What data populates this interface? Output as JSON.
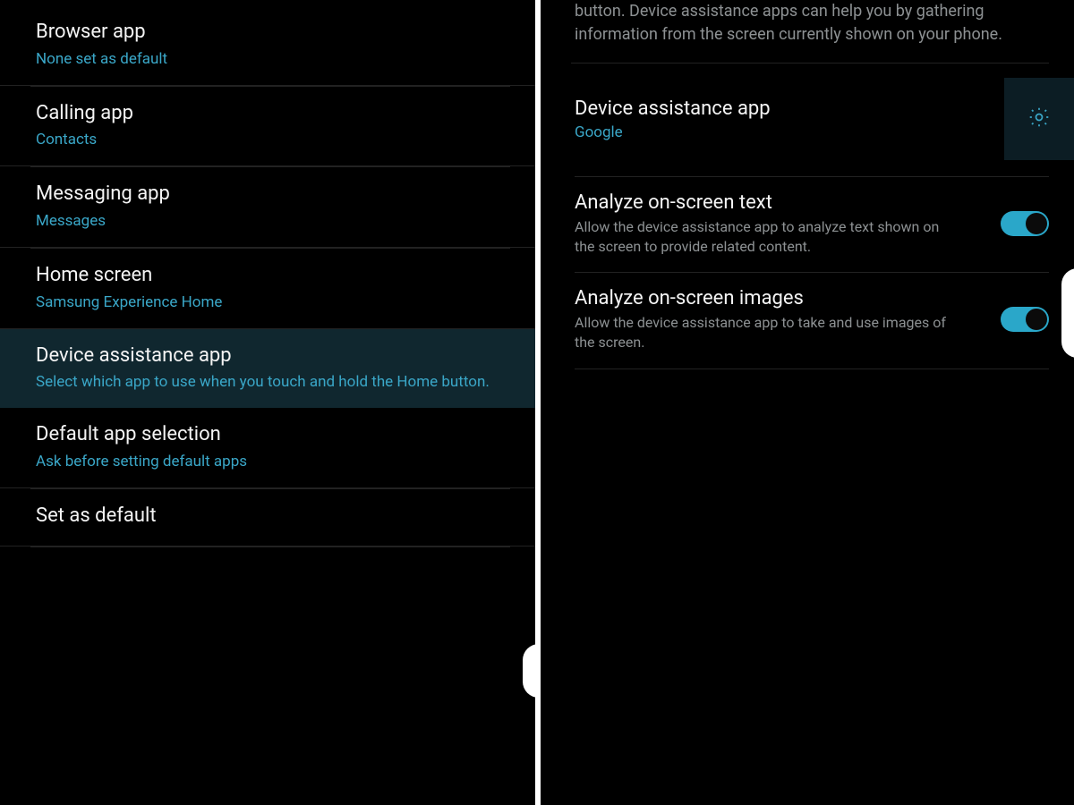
{
  "left": {
    "items": [
      {
        "title": "Browser app",
        "sub": "None set as default"
      },
      {
        "title": "Calling app",
        "sub": "Contacts"
      },
      {
        "title": "Messaging app",
        "sub": "Messages"
      },
      {
        "title": "Home screen",
        "sub": "Samsung Experience Home"
      },
      {
        "title": "Device assistance app",
        "sub": "Select which app to use when you touch and hold the Home button."
      },
      {
        "title": "Default app selection",
        "sub": "Ask before setting default apps"
      },
      {
        "title": "Set as default",
        "sub": ""
      }
    ],
    "selected_index": 4
  },
  "right": {
    "top_desc": "button. Device assistance apps can help you by gathering information from the screen currently shown on your phone.",
    "device_row": {
      "title": "Device assistance app",
      "sub": "Google"
    },
    "toggles": [
      {
        "title": "Analyze on-screen text",
        "desc": "Allow the device assistance app to analyze text shown on the screen to provide related content.",
        "on": true
      },
      {
        "title": "Analyze on-screen images",
        "desc": "Allow the device assistance app to take and use images of the screen.",
        "on": true
      }
    ]
  },
  "colors": {
    "accent": "#3aa7c8",
    "selected_bg": "#10272f"
  }
}
